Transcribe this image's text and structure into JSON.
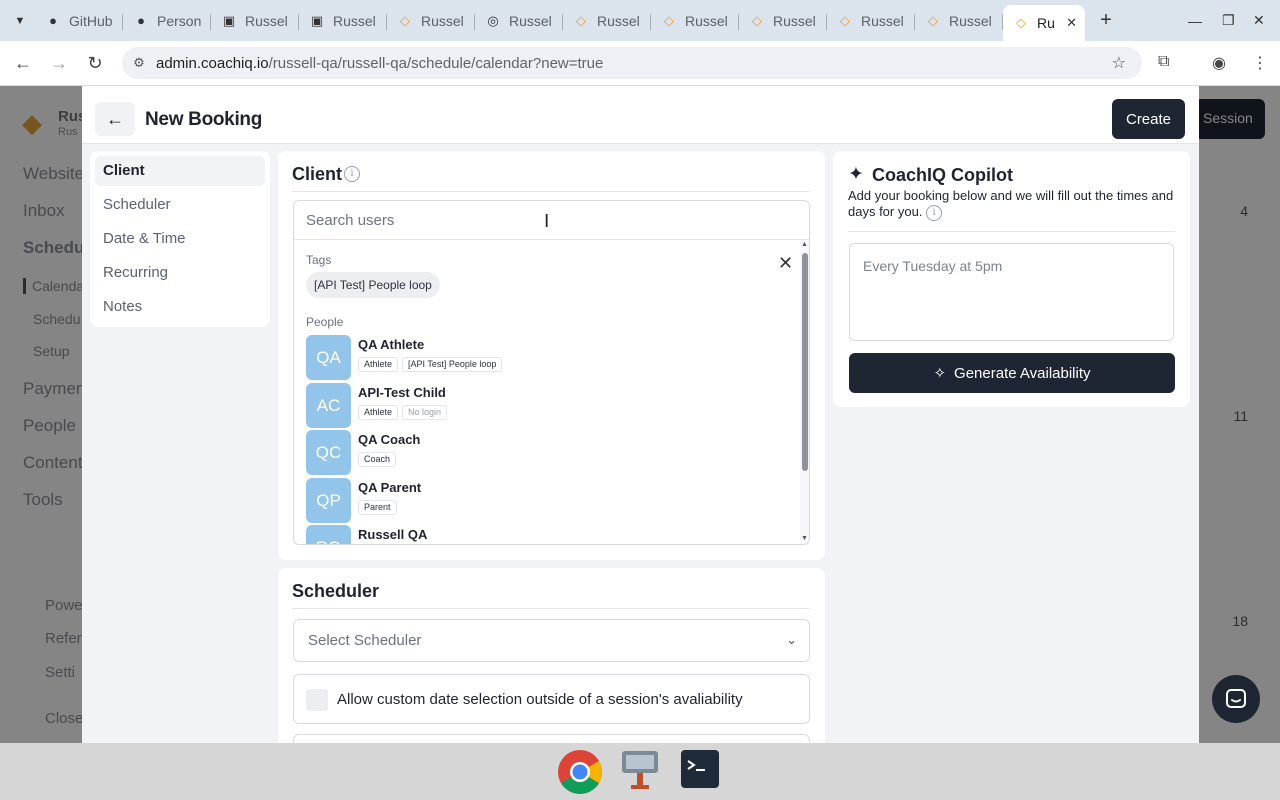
{
  "browser": {
    "tabs": [
      {
        "label": "GitHub",
        "icon": "github-icon"
      },
      {
        "label": "Person",
        "icon": "github-icon"
      },
      {
        "label": "Russel",
        "icon": "folder-icon"
      },
      {
        "label": "Russel",
        "icon": "folder-icon"
      },
      {
        "label": "Russel",
        "icon": "diamond-icon"
      },
      {
        "label": "Russel",
        "icon": "globe-icon"
      },
      {
        "label": "Russel",
        "icon": "diamond-icon"
      },
      {
        "label": "Russel",
        "icon": "diamond-icon"
      },
      {
        "label": "Russel",
        "icon": "diamond-icon"
      },
      {
        "label": "Russel",
        "icon": "diamond-icon"
      },
      {
        "label": "Russel",
        "icon": "diamond-icon"
      }
    ],
    "active_tab": {
      "label": "Ru",
      "icon": "diamond-icon"
    },
    "url_host": "admin.coachiq.io",
    "url_path": "/russell-qa/russell-qa/schedule/calendar?new=true"
  },
  "background": {
    "sidebar": {
      "brand": "Rus",
      "brand_sub": "Rus",
      "items": [
        "Website",
        "Inbox",
        "Schedul"
      ],
      "sub_items": [
        "Calenda",
        "Schedu",
        "Setup"
      ],
      "more_items": [
        "Paymen",
        "People",
        "Content",
        "Tools"
      ],
      "footer_items": [
        "Powe",
        "Refer",
        "Setti",
        "Close"
      ]
    },
    "right": {
      "button": "Session",
      "numbers": [
        "4",
        "11",
        "18"
      ]
    }
  },
  "modal": {
    "title": "New Booking",
    "create_label": "Create",
    "steps": [
      "Client",
      "Scheduler",
      "Date & Time",
      "Recurring",
      "Notes"
    ],
    "client": {
      "title": "Client",
      "search_placeholder": "Search users",
      "tags_label": "Tags",
      "tag": "[API Test] People loop",
      "people_label": "People",
      "people": [
        {
          "initials": "QA",
          "name": "QA Athlete",
          "badges": [
            "Athlete",
            "[API Test] People loop"
          ]
        },
        {
          "initials": "AC",
          "name": "API-Test Child",
          "badges": [
            "Athlete",
            "No login"
          ]
        },
        {
          "initials": "QC",
          "name": "QA Coach",
          "badges": [
            "Coach"
          ]
        },
        {
          "initials": "QP",
          "name": "QA Parent",
          "badges": [
            "Parent"
          ]
        },
        {
          "initials": "RQ",
          "name": "Russell QA",
          "badges": []
        }
      ]
    },
    "scheduler": {
      "title": "Scheduler",
      "select_placeholder": "Select Scheduler",
      "custom_date_label": "Allow custom date selection outside of a session's avaliability"
    },
    "copilot": {
      "title": "CoachIQ Copilot",
      "description": "Add your booking below and we will fill out the times and days for you.",
      "input_placeholder": "Every Tuesday at 5pm",
      "generate_label": "Generate Availability"
    }
  }
}
